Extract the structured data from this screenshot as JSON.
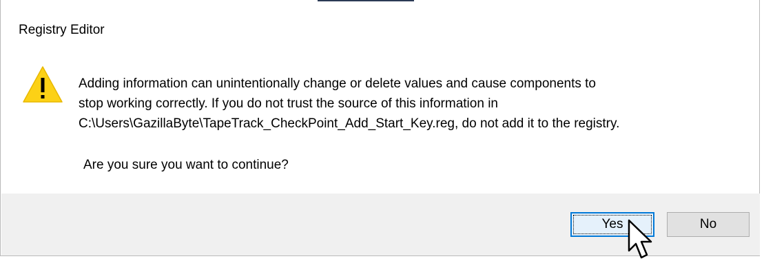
{
  "window": {
    "title": "Registry Editor"
  },
  "message": {
    "line1": "Adding information can unintentionally change or delete values and cause components to",
    "line2": "stop working correctly. If you do not trust the source of this information in",
    "line3": "C:\\Users\\GazillaByte\\TapeTrack_CheckPoint_Add_Start_Key.reg, do not add it to the registry.",
    "question": "Are you sure you want to continue?"
  },
  "icons": {
    "warning": "warning-icon",
    "cursor": "mouse-pointer-icon"
  },
  "buttons": {
    "yes_label": "Yes",
    "no_label": "No"
  },
  "colors": {
    "warning_fill": "#fcd116",
    "focus_border": "#0078d7",
    "footer_bg": "#f0f0f0"
  }
}
